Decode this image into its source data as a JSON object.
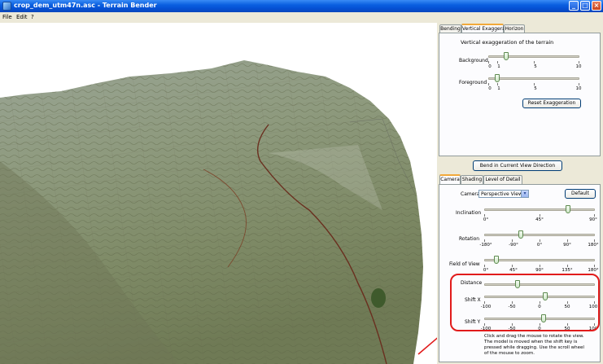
{
  "window": {
    "title": "crop_dem_utm47n.asc - Terrain Bender",
    "controls": [
      "_",
      "□",
      "×"
    ]
  },
  "menu": [
    "File",
    "Edit",
    "?"
  ],
  "top_tabs": [
    "Bending",
    "Vertical Exaggeration",
    "Horizon"
  ],
  "exaggeration": {
    "heading": "Vertical exaggeration of the terrain",
    "background": {
      "label": "Background",
      "ticks": [
        "0",
        "1",
        "5",
        "10"
      ],
      "value": 2
    },
    "foreground": {
      "label": "Foreground",
      "ticks": [
        "0",
        "1",
        "5",
        "10"
      ],
      "value": 1
    },
    "reset_label": "Reset Exaggeration"
  },
  "bend_label": "Bend in Current View Direction",
  "bottom_tabs": [
    "Camera",
    "Shading",
    "Level of Detail"
  ],
  "camera": {
    "label": "Camera",
    "selected": "Perspective View",
    "default_label": "Default",
    "inclination": {
      "label": "Inclination",
      "ticks": [
        "0°",
        "45°",
        "90°"
      ],
      "value": 68
    },
    "rotation": {
      "label": "Rotation",
      "ticks": [
        "-180°",
        "-90°",
        "0°",
        "90°",
        "180°"
      ],
      "value": -60
    },
    "fov": {
      "label": "Field of View",
      "ticks": [
        "0°",
        "45°",
        "90°",
        "135°",
        "180°"
      ],
      "value": 20
    },
    "distance": {
      "label": "Distance",
      "value": 0.3
    },
    "shift_x": {
      "label": "Shift X",
      "ticks": [
        "-100",
        "-50",
        "0",
        "50",
        "100"
      ],
      "value": 10
    },
    "shift_y": {
      "label": "Shift Y",
      "ticks": [
        "-100",
        "-50",
        "0",
        "50",
        "100"
      ],
      "value": 8
    },
    "help": [
      "Click and drag the mouse to rotate the view.",
      "The model is moved when the shift key is",
      "pressed while dragging. Use the scroll wheel",
      "of the mouse to zoom."
    ]
  }
}
